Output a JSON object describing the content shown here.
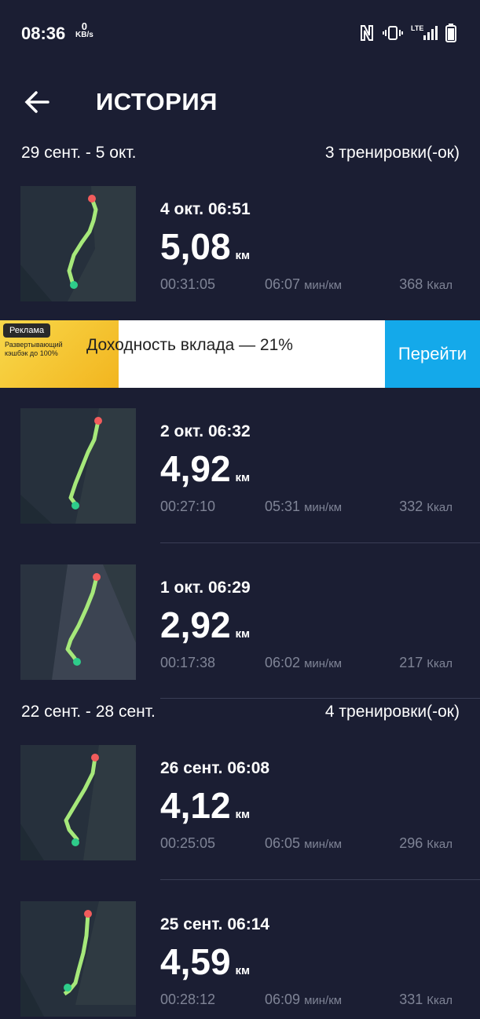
{
  "status": {
    "time": "08:36",
    "kb_value": "0",
    "kb_unit": "KB/s",
    "net_label": "LTE"
  },
  "header": {
    "title": "ИСТОРИЯ"
  },
  "weeks": [
    {
      "range": "29 сент. - 5 окт.",
      "count": "3 тренировки(-ок)"
    },
    {
      "range": "22 сент. - 28 сент.",
      "count": "4 тренировки(-ок)"
    }
  ],
  "workouts": [
    {
      "date": "4 окт. 06:51",
      "distance": "5,08",
      "unit": "км",
      "duration": "00:31:05",
      "pace": "06:07",
      "pace_unit": "мин/км",
      "calories": "368",
      "cal_unit": "Ккал"
    },
    {
      "date": "2 окт. 06:32",
      "distance": "4,92",
      "unit": "км",
      "duration": "00:27:10",
      "pace": "05:31",
      "pace_unit": "мин/км",
      "calories": "332",
      "cal_unit": "Ккал"
    },
    {
      "date": "1 окт. 06:29",
      "distance": "2,92",
      "unit": "км",
      "duration": "00:17:38",
      "pace": "06:02",
      "pace_unit": "мин/км",
      "calories": "217",
      "cal_unit": "Ккал"
    },
    {
      "date": "26 сент. 06:08",
      "distance": "4,12",
      "unit": "км",
      "duration": "00:25:05",
      "pace": "06:05",
      "pace_unit": "мин/км",
      "calories": "296",
      "cal_unit": "Ккал"
    },
    {
      "date": "25 сент. 06:14",
      "distance": "4,59",
      "unit": "км",
      "duration": "00:28:12",
      "pace": "06:09",
      "pace_unit": "мин/км",
      "calories": "331",
      "cal_unit": "Ккал"
    }
  ],
  "ad": {
    "tag": "Реклама",
    "small": "Развертывающий кэшбэк до 100%",
    "text": "Доходность вклада — 21%",
    "button": "Перейти"
  },
  "colors": {
    "background": "#1b1e33",
    "route": "#a6e87a",
    "start": "#2ecc8a",
    "end": "#f25c5c",
    "ad_button": "#14a9ea"
  }
}
